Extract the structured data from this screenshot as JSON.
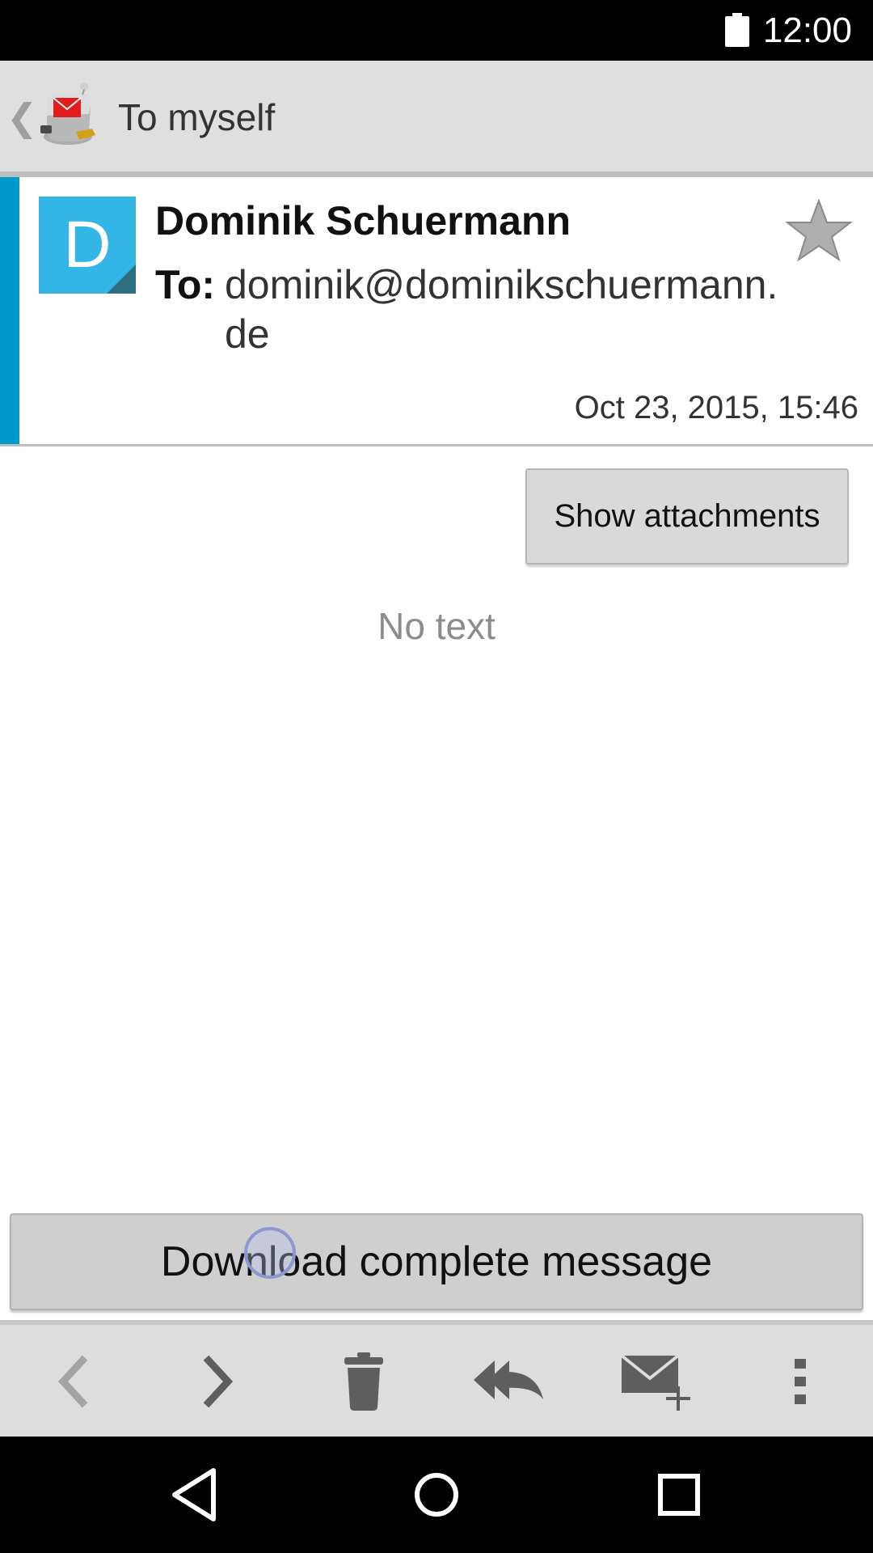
{
  "status_bar": {
    "time": "12:00"
  },
  "action_bar": {
    "title": "To myself"
  },
  "message": {
    "avatar_letter": "D",
    "sender_name": "Dominik Schuermann",
    "to_label": "To:",
    "to_address": "dominik@dominikschuermann.de",
    "date": "Oct 23, 2015, 15:46",
    "body_placeholder": "No text"
  },
  "buttons": {
    "show_attachments": "Show attachments",
    "download_complete": "Download complete message"
  },
  "toolbar": {
    "items": [
      {
        "icon": "chevron-left-icon",
        "enabled": false
      },
      {
        "icon": "chevron-right-icon",
        "enabled": true
      },
      {
        "icon": "trash-icon",
        "enabled": true
      },
      {
        "icon": "reply-all-icon",
        "enabled": true
      },
      {
        "icon": "compose-icon",
        "enabled": true
      },
      {
        "icon": "overflow-menu-icon",
        "enabled": true
      }
    ]
  },
  "colors": {
    "accent": "#0099cc",
    "avatar": "#33b5e5",
    "action_bar": "#dfdfdf",
    "toolbar": "#dddddd"
  }
}
